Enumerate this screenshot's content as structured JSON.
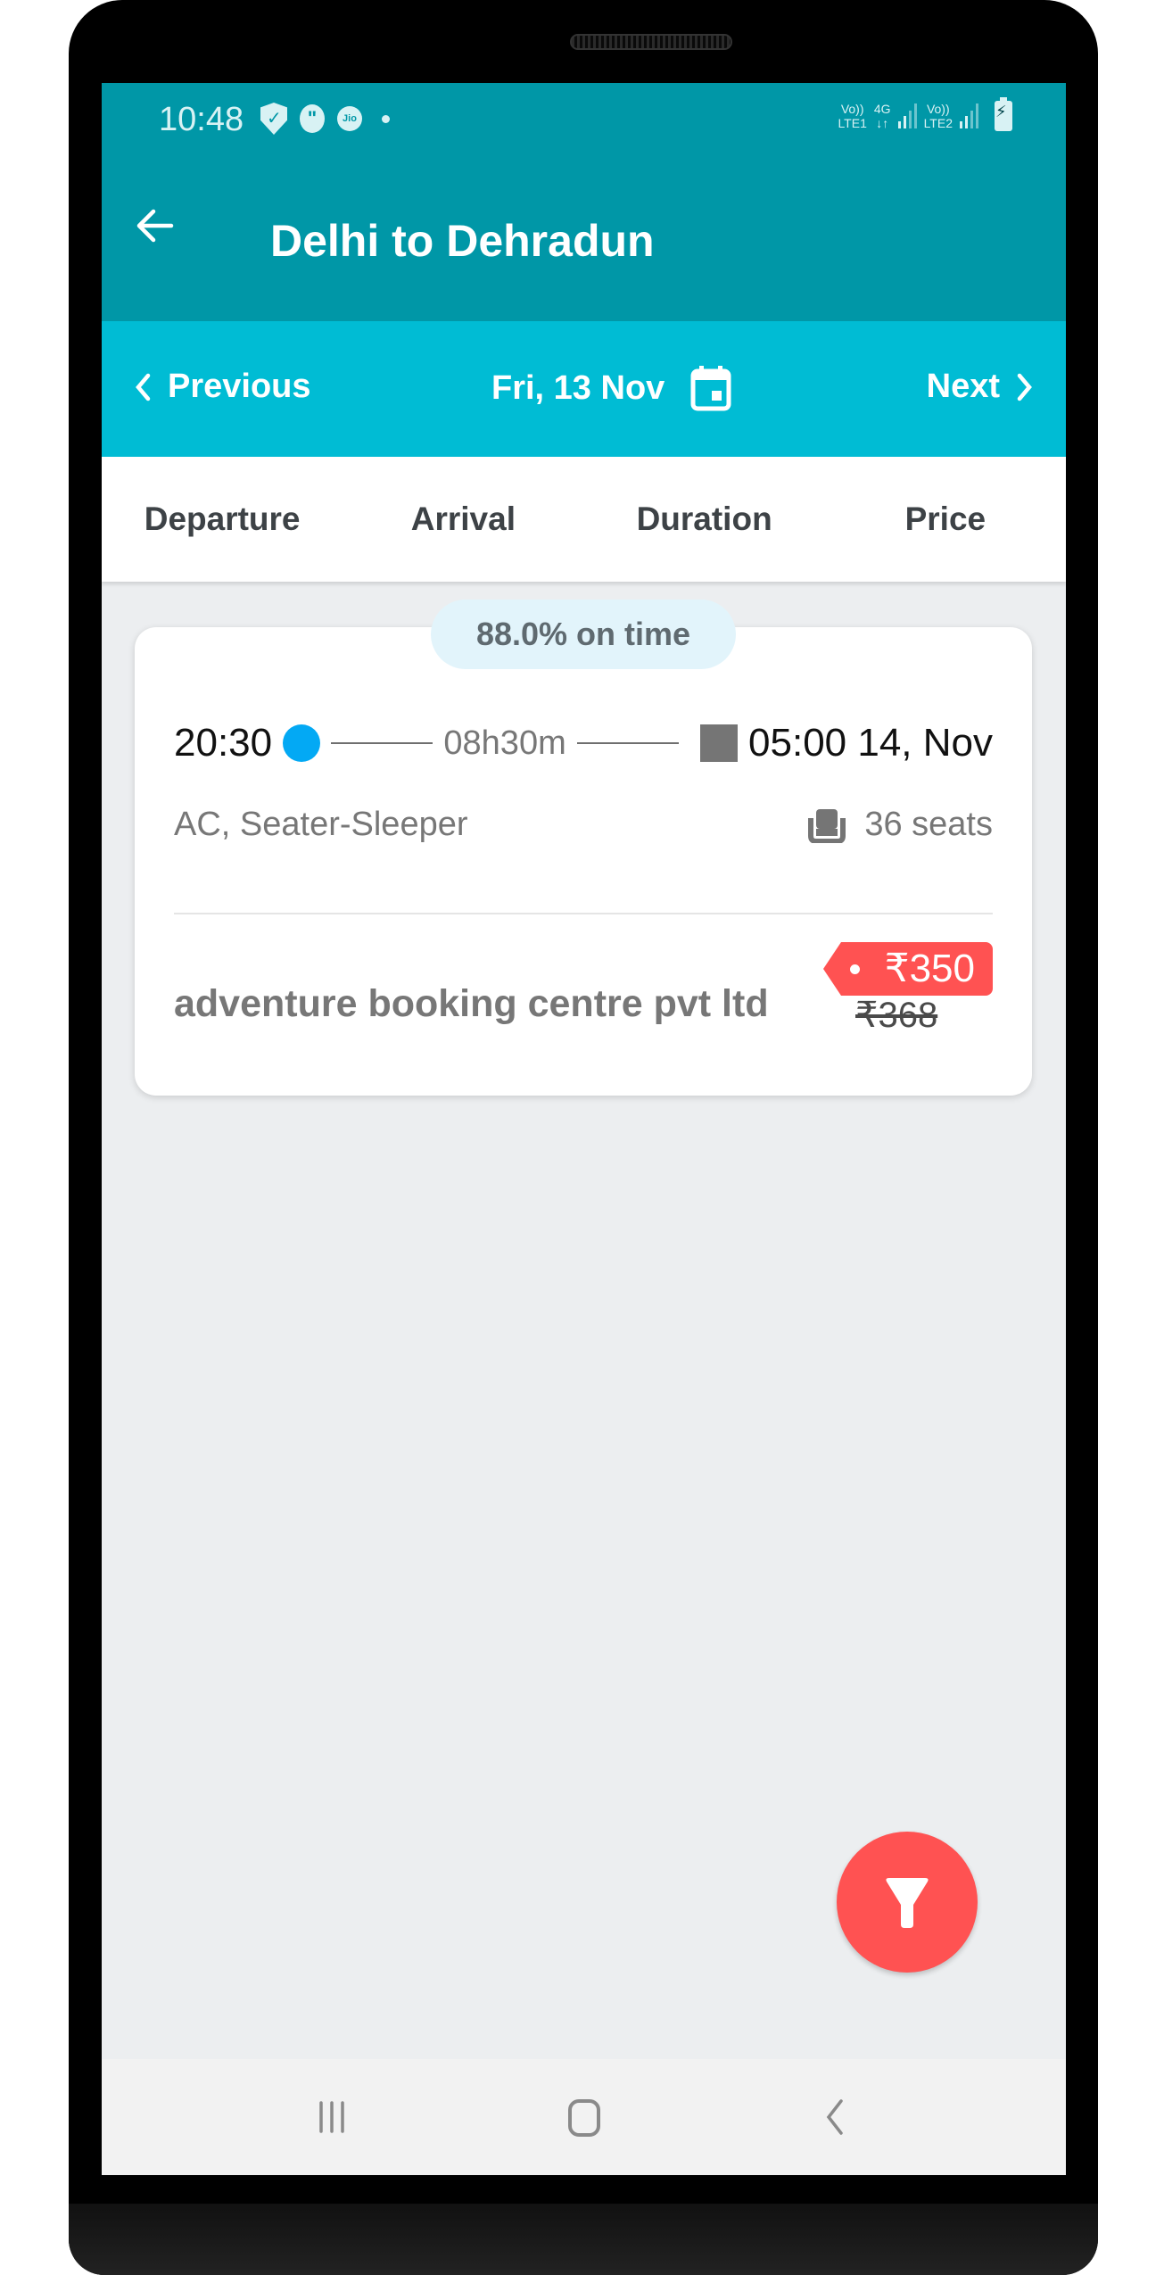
{
  "status_bar": {
    "time": "10:48",
    "left_icons": [
      "shield-check-icon",
      "chat-quote-icon",
      "jio-icon",
      "notification-dot-icon"
    ],
    "sim1": {
      "top": "Vo))",
      "bottom": "LTE1"
    },
    "network": {
      "top": "4G",
      "bottom": "↓↑"
    },
    "sim2": {
      "top": "Vo))",
      "bottom": "LTE2"
    },
    "battery_icon": "battery-charging-icon"
  },
  "toolbar": {
    "back_icon": "arrow-left-icon",
    "title": "Delhi to Dehradun"
  },
  "date_bar": {
    "previous_label": "Previous",
    "date_label": "Fri, 13 Nov",
    "calendar_icon": "calendar-icon",
    "next_label": "Next"
  },
  "sort_tabs": [
    "Departure",
    "Arrival",
    "Duration",
    "Price"
  ],
  "results": [
    {
      "on_time": "88.0% on time",
      "departure_time": "20:30",
      "duration": "08h30m",
      "arrival_time": "05:00 14, Nov",
      "bus_type": "AC, Seater-Sleeper",
      "seats": "36 seats",
      "operator": "adventure booking centre pvt ltd",
      "price": "₹350",
      "original_price": "₹368"
    }
  ],
  "fab": {
    "icon": "filter-icon"
  },
  "nav_bar": {
    "icons": [
      "recent-apps-icon",
      "home-icon",
      "back-icon"
    ]
  },
  "colors": {
    "toolbar": "#0097A7",
    "date_bar": "#00BCD4",
    "accent_red": "#FF5252",
    "departure_dot": "#03A9F4",
    "ontime_pill": "#E2F4FB",
    "background": "#ECEEF0"
  }
}
